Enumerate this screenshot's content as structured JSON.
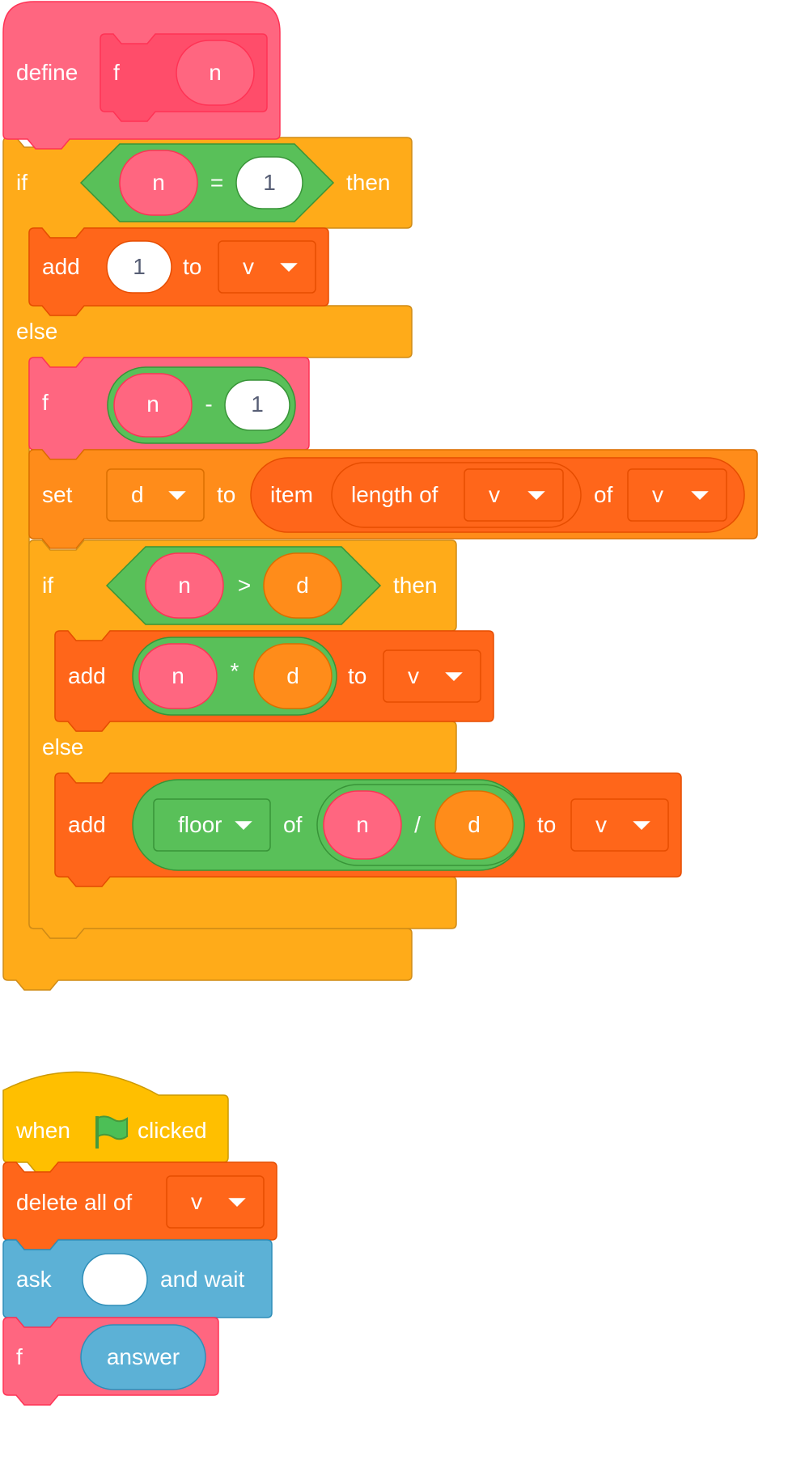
{
  "colors": {
    "custom": "#ff6680",
    "custom_dark": "#ff4d6a",
    "custom_border": "#ff3355",
    "control": "#ffab19",
    "control_border": "#cf8b17",
    "list": "#ff661a",
    "list_border": "#e64d00",
    "variable": "#ff8c1a",
    "variable_border": "#db6e00",
    "operator": "#59c059",
    "operator_border": "#389438",
    "event": "#ffbf00",
    "event_border": "#cc9900",
    "sensing": "#5cb1d6",
    "sensing_border": "#2e8eb8",
    "input_text": "#575e75"
  },
  "script1": {
    "define": {
      "keyword": "define",
      "name": "f",
      "param": "n"
    },
    "if_outer": {
      "if": "if",
      "then": "then",
      "else": "else",
      "condition": {
        "left": "n",
        "op": "=",
        "right": "1"
      }
    },
    "add1": {
      "add": "add",
      "value": "1",
      "to": "to",
      "list": "v"
    },
    "call_f": {
      "name": "f",
      "arg_left": "n",
      "op": "-",
      "arg_right": "1"
    },
    "set": {
      "set": "set",
      "var": "d",
      "to": "to",
      "item": "item",
      "length_of": "length of",
      "list1": "v",
      "of": "of",
      "list2": "v"
    },
    "if_inner": {
      "if": "if",
      "then": "then",
      "else": "else",
      "condition": {
        "left": "n",
        "op": ">",
        "right": "d"
      }
    },
    "add_mul": {
      "add": "add",
      "left": "n",
      "op": "*",
      "right": "d",
      "to": "to",
      "list": "v"
    },
    "add_floor": {
      "add": "add",
      "func": "floor",
      "of": "of",
      "left": "n",
      "op": "/",
      "right": "d",
      "to": "to",
      "list": "v"
    }
  },
  "script2": {
    "hat": {
      "when": "when",
      "clicked": "clicked",
      "icon": "green-flag-icon"
    },
    "delete": {
      "label": "delete all of",
      "list": "v"
    },
    "ask": {
      "ask": "ask",
      "value": "",
      "wait": "and wait"
    },
    "call_f": {
      "name": "f",
      "arg": "answer"
    }
  }
}
